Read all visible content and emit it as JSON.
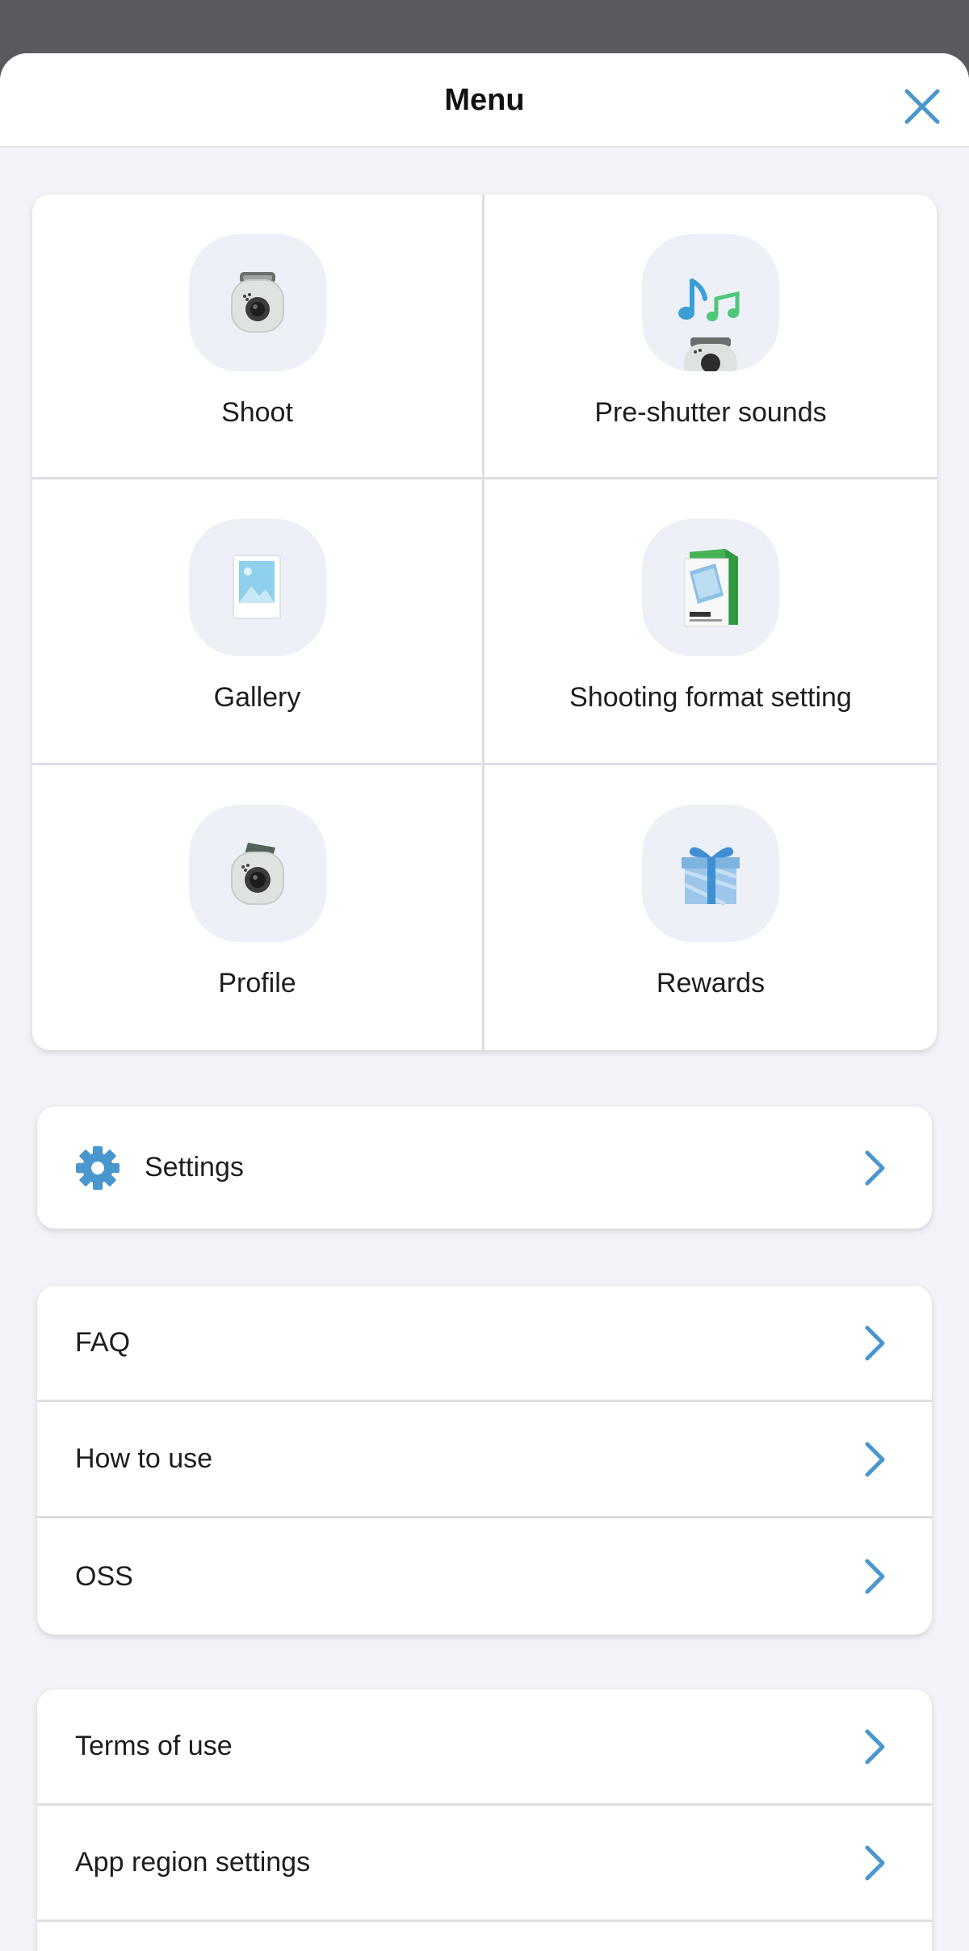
{
  "header": {
    "title": "Menu"
  },
  "grid": [
    {
      "label": "Shoot",
      "icon": "camera-icon"
    },
    {
      "label": "Pre-shutter sounds",
      "icon": "music-notes-camera-icon"
    },
    {
      "label": "Gallery",
      "icon": "photo-print-icon"
    },
    {
      "label": "Shooting format setting",
      "icon": "film-pack-icon"
    },
    {
      "label": "Profile",
      "icon": "camera-profile-icon"
    },
    {
      "label": "Rewards",
      "icon": "gift-icon"
    }
  ],
  "settings": {
    "label": "Settings",
    "icon": "gear-icon"
  },
  "help": [
    {
      "label": "FAQ"
    },
    {
      "label": "How to use"
    },
    {
      "label": "OSS"
    }
  ],
  "legal": [
    {
      "label": "Terms of use"
    },
    {
      "label": "App region settings"
    }
  ],
  "colors": {
    "accent": "#4a96cf",
    "background": "#f2f3f8",
    "overlay": "#5a5b5e"
  }
}
